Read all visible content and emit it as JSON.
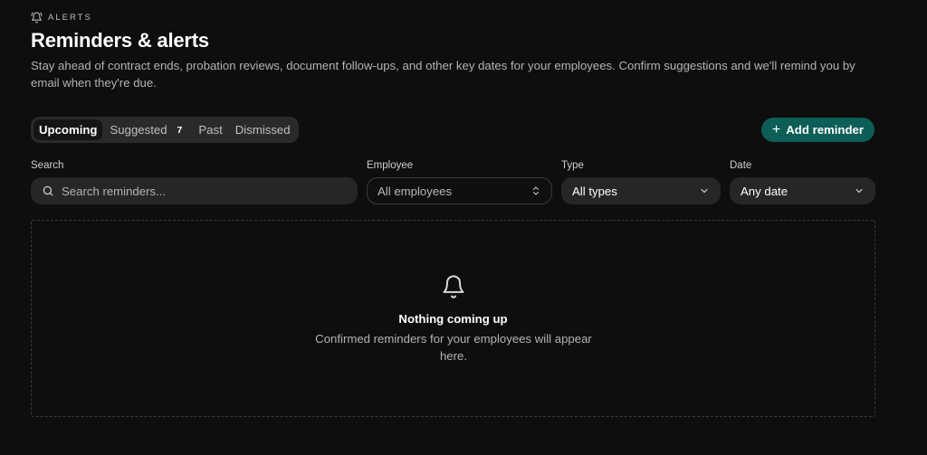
{
  "header": {
    "eyebrow": "ALERTS",
    "eyebrow_icon": "bell-icon",
    "title": "Reminders & alerts",
    "subtitle": "Stay ahead of contract ends, probation reviews, document follow-ups, and other key dates for your employees. Confirm suggestions and we'll remind you by email when they're due."
  },
  "tabs": [
    {
      "label": "Upcoming",
      "active": true
    },
    {
      "label": "Suggested",
      "badge": "7"
    },
    {
      "label": "Past"
    },
    {
      "label": "Dismissed"
    }
  ],
  "add_button": {
    "label": "Add reminder",
    "icon": "plus-icon",
    "color": "#0c5e56"
  },
  "filters": {
    "search": {
      "label": "Search",
      "placeholder": "Search reminders...",
      "value": ""
    },
    "employee": {
      "label": "Employee",
      "value": "All employees"
    },
    "type": {
      "label": "Type",
      "value": "All types"
    },
    "date": {
      "label": "Date",
      "value": "Any date"
    }
  },
  "empty_state": {
    "icon": "bell-icon",
    "title": "Nothing coming up",
    "text": "Confirmed reminders for your employees will appear here."
  }
}
